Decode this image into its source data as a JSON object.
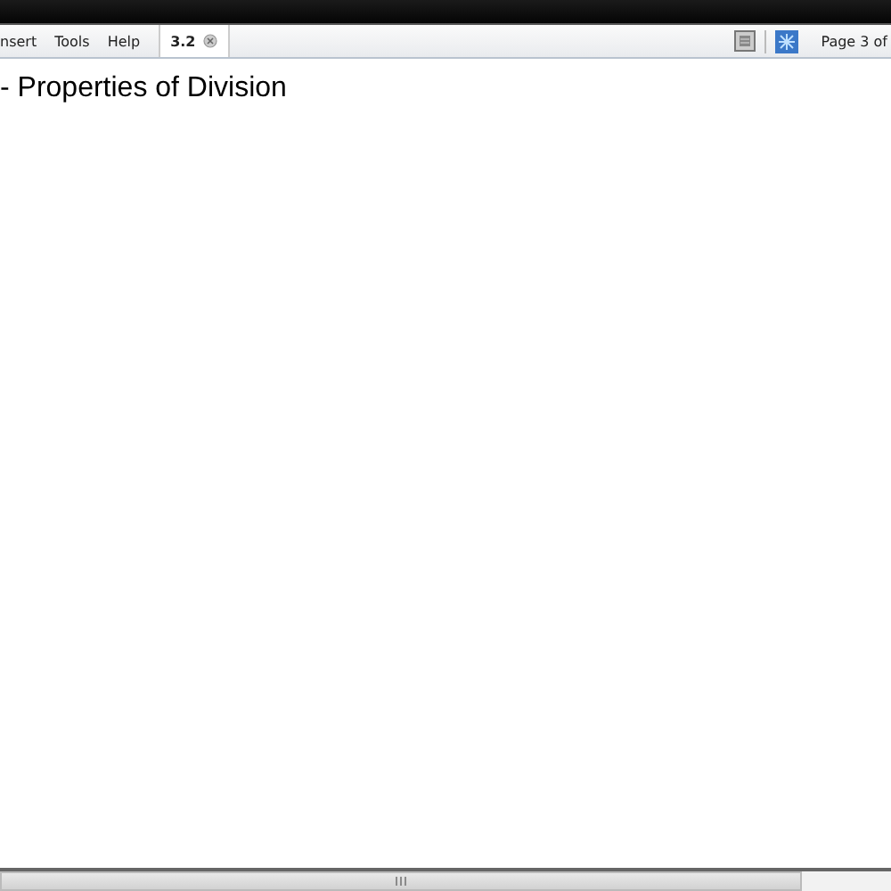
{
  "menu": [
    "nsert",
    "Tools",
    "Help"
  ],
  "tabs": [
    {
      "label": "3.2",
      "selected": true
    }
  ],
  "page_indicator": "Page 3 of",
  "page": {
    "title": "- Properties of Division"
  }
}
